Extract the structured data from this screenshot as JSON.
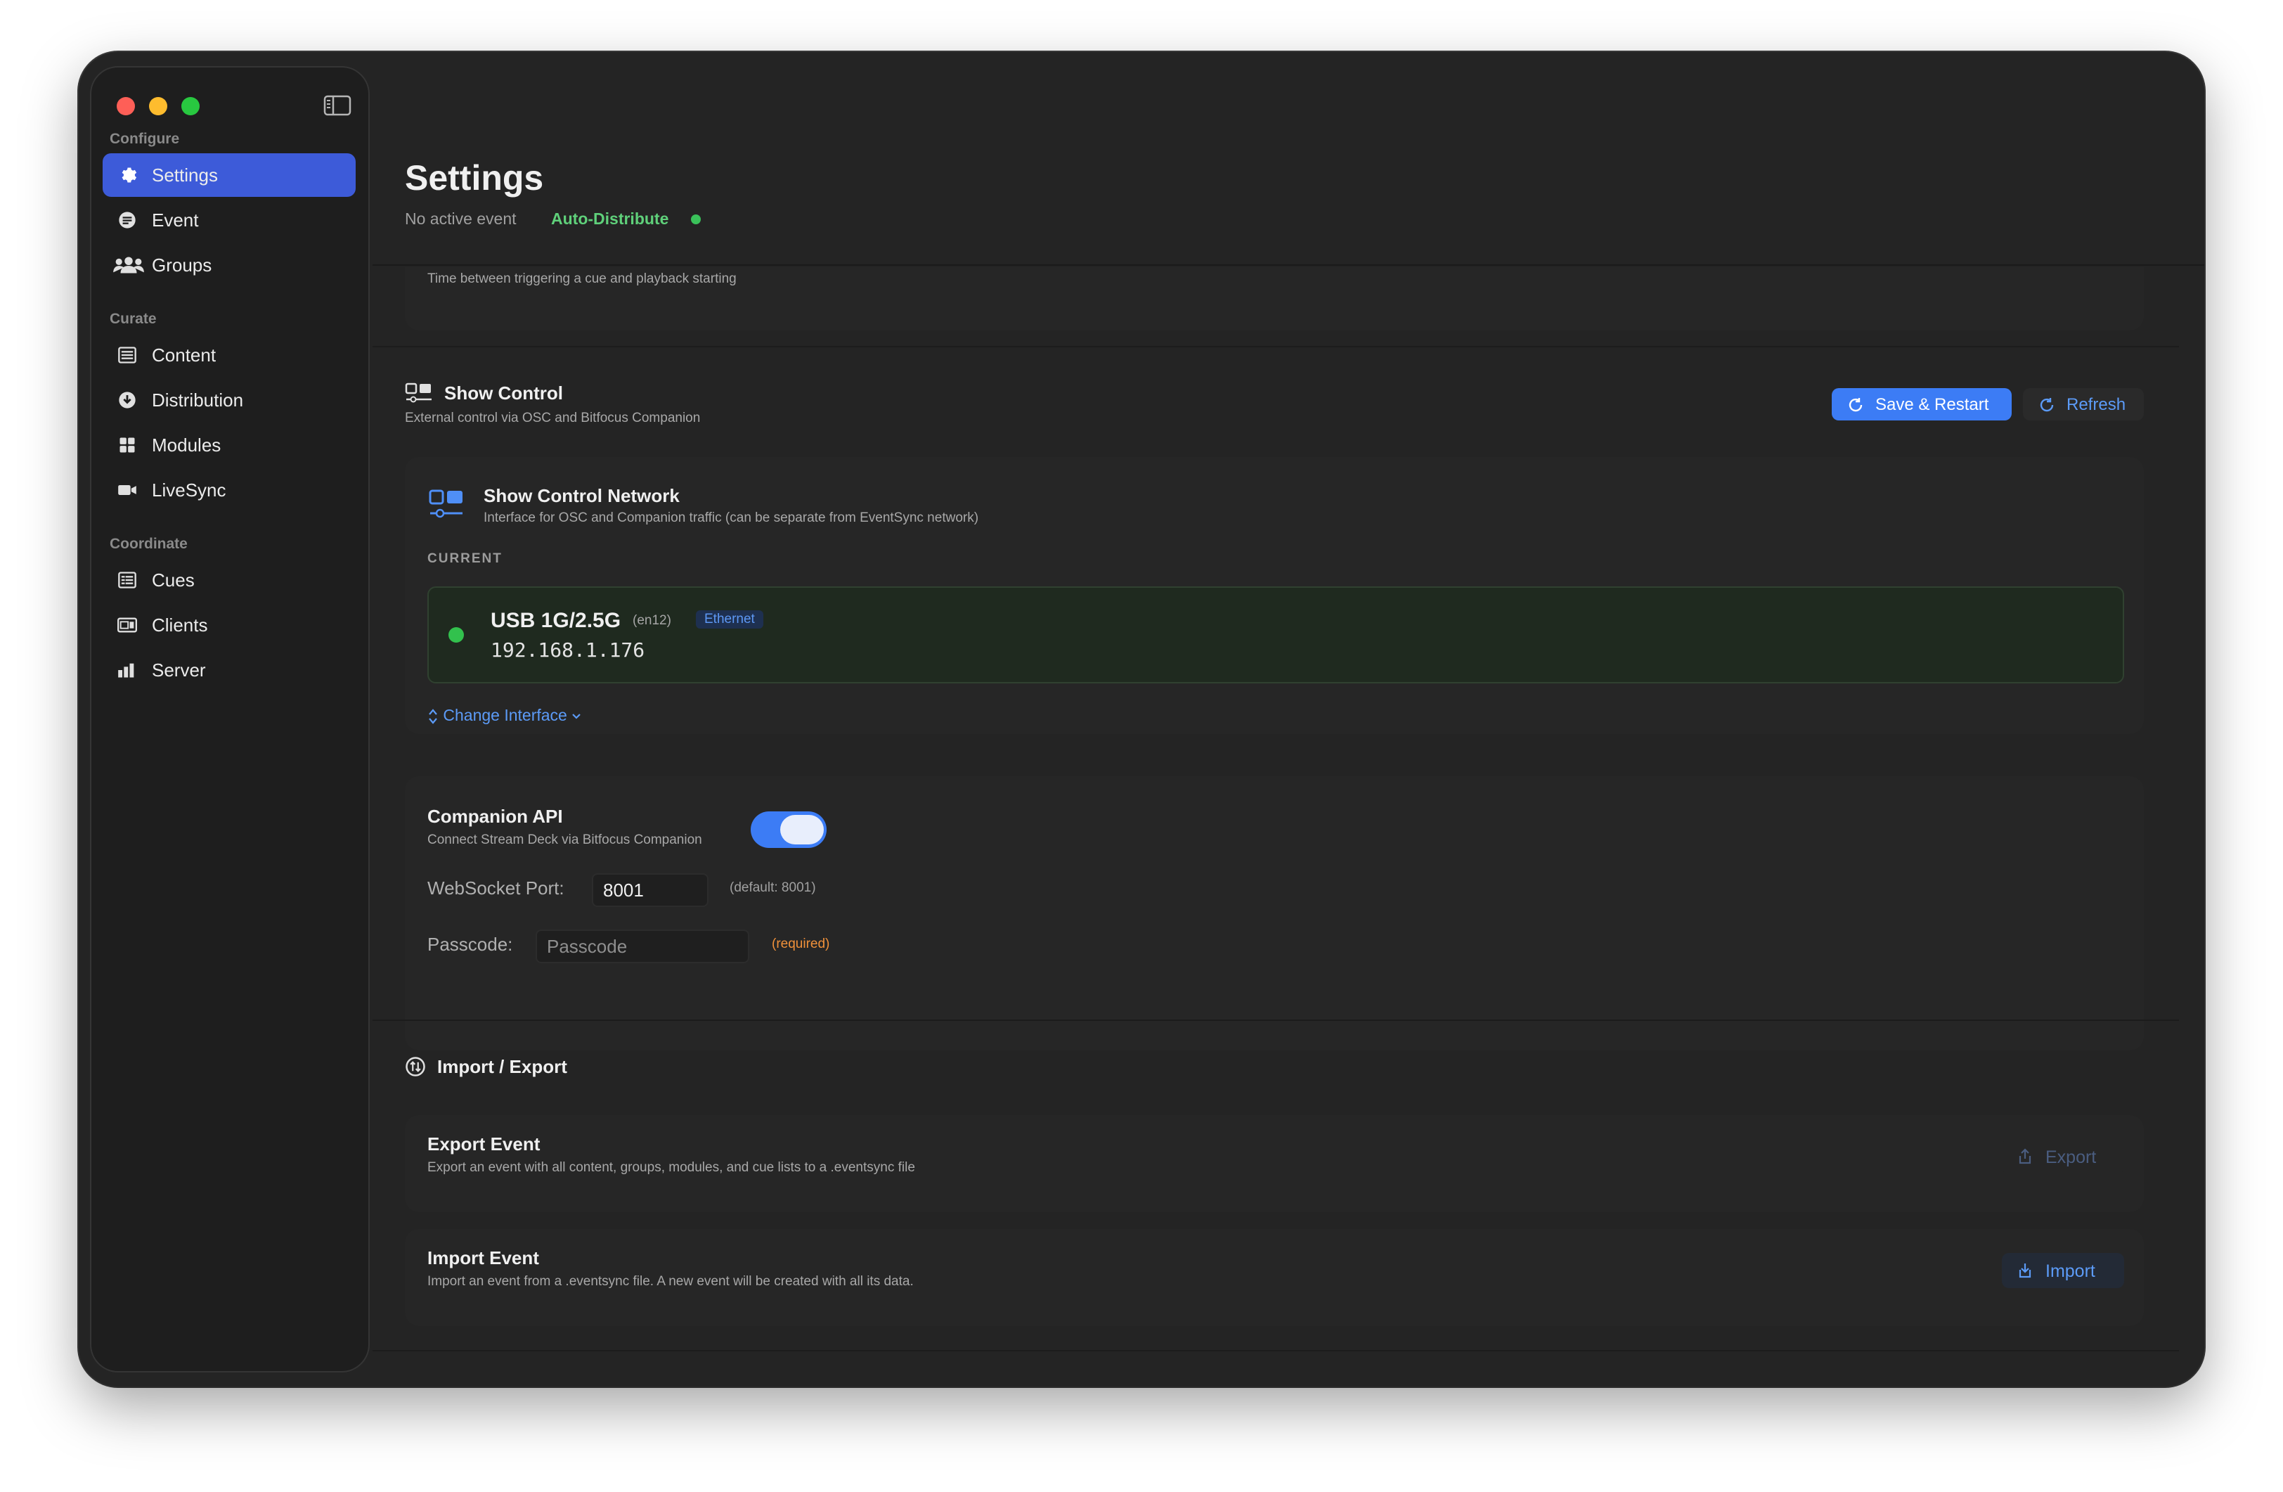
{
  "sidebar": {
    "sections": [
      {
        "label": "Configure"
      },
      {
        "label": "Curate"
      },
      {
        "label": "Coordinate"
      }
    ],
    "items": [
      {
        "label": "Settings",
        "icon": "gear-icon",
        "active": true
      },
      {
        "label": "Event",
        "icon": "event-icon"
      },
      {
        "label": "Groups",
        "icon": "groups-icon"
      },
      {
        "label": "Content",
        "icon": "content-icon"
      },
      {
        "label": "Distribution",
        "icon": "distribution-icon"
      },
      {
        "label": "Modules",
        "icon": "modules-icon"
      },
      {
        "label": "LiveSync",
        "icon": "camera-icon"
      },
      {
        "label": "Cues",
        "icon": "cues-icon"
      },
      {
        "label": "Clients",
        "icon": "clients-icon"
      },
      {
        "label": "Server",
        "icon": "server-icon"
      }
    ]
  },
  "header": {
    "title": "Settings",
    "event_status": "No active event",
    "auto_distribute": "Auto-Distribute"
  },
  "previous_setting": {
    "description": "Time between triggering a cue and playback starting"
  },
  "show_control": {
    "title": "Show Control",
    "description": "External control via OSC and Bitfocus Companion",
    "save_label": "Save & Restart",
    "refresh_label": "Refresh",
    "network": {
      "title": "Show Control Network",
      "description": "Interface for OSC and Companion traffic (can be separate from EventSync network)",
      "current_label": "CURRENT",
      "interface_name": "USB 1G/2.5G",
      "device": "(en12)",
      "type": "Ethernet",
      "ip": "192.168.1.176",
      "change_label": "Change Interface"
    },
    "companion": {
      "title": "Companion API",
      "description": "Connect Stream Deck via Bitfocus Companion",
      "enabled": true,
      "port_label": "WebSocket Port:",
      "port_value": "8001",
      "port_default": "(default: 8001)",
      "passcode_label": "Passcode:",
      "passcode_placeholder": "Passcode",
      "passcode_required": "(required)"
    }
  },
  "import_export": {
    "title": "Import / Export",
    "export": {
      "title": "Export Event",
      "description": "Export an event with all content, groups, modules, and cue lists to a .eventsync file",
      "button": "Export"
    },
    "import": {
      "title": "Import Event",
      "description": "Import an event from a .eventsync file. A new event will be created with all its data.",
      "button": "Import"
    }
  },
  "colors": {
    "accent": "#3c7cf5",
    "success": "#3ac15a",
    "warning": "#f0913a",
    "sidebar_active": "#3d5bd9"
  }
}
